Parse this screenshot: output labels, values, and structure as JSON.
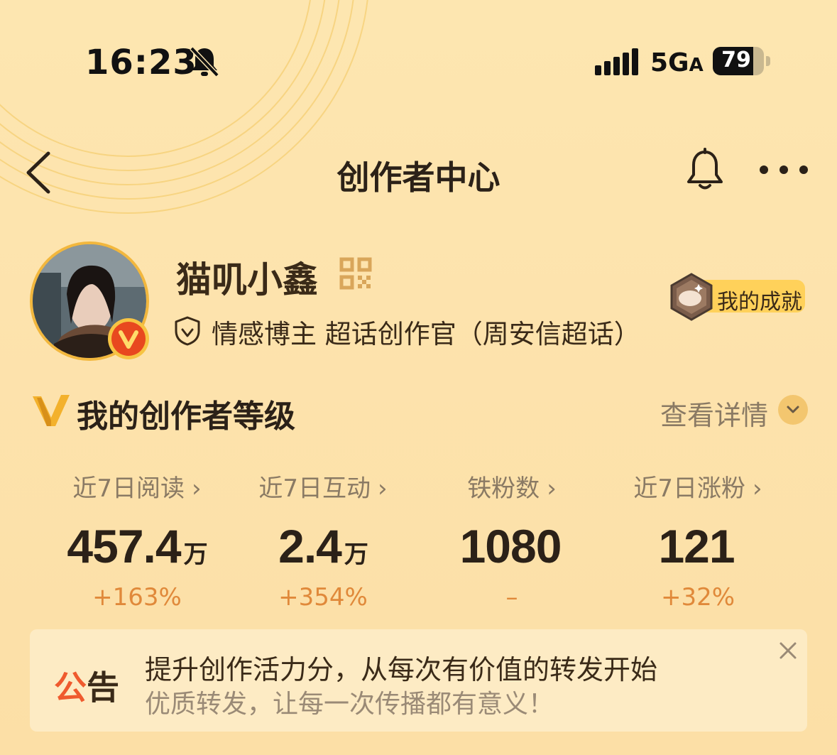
{
  "status_bar": {
    "time": "16:23",
    "network": "5G",
    "network_suffix": "A",
    "battery": "79",
    "battery_level": 0.79
  },
  "nav": {
    "title": "创作者中心"
  },
  "profile": {
    "username": "猫叽小鑫",
    "tagline": "情感博主 超话创作官（周安信超话）",
    "achievement_label": "我的成就"
  },
  "level": {
    "title": "我的创作者等级",
    "detail_label": "查看详情"
  },
  "stats": [
    {
      "label": "近7日阅读",
      "value": "457.4",
      "unit": "万",
      "change": "+163%"
    },
    {
      "label": "近7日互动",
      "value": "2.4",
      "unit": "万",
      "change": "+354%"
    },
    {
      "label": "铁粉数",
      "value": "1080",
      "unit": "",
      "change": "–"
    },
    {
      "label": "近7日涨粉",
      "value": "121",
      "unit": "",
      "change": "+32%"
    }
  ],
  "notice": {
    "tag_first": "公",
    "tag_second": "告",
    "title": "提升创作活力分，从每次有价值的转发开始",
    "subtitle": "优质转发，让每一次传播都有意义！"
  },
  "colors": {
    "accent_orange": "#e0893a",
    "badge_red": "#e8481f",
    "gold": "#f2b73d"
  }
}
